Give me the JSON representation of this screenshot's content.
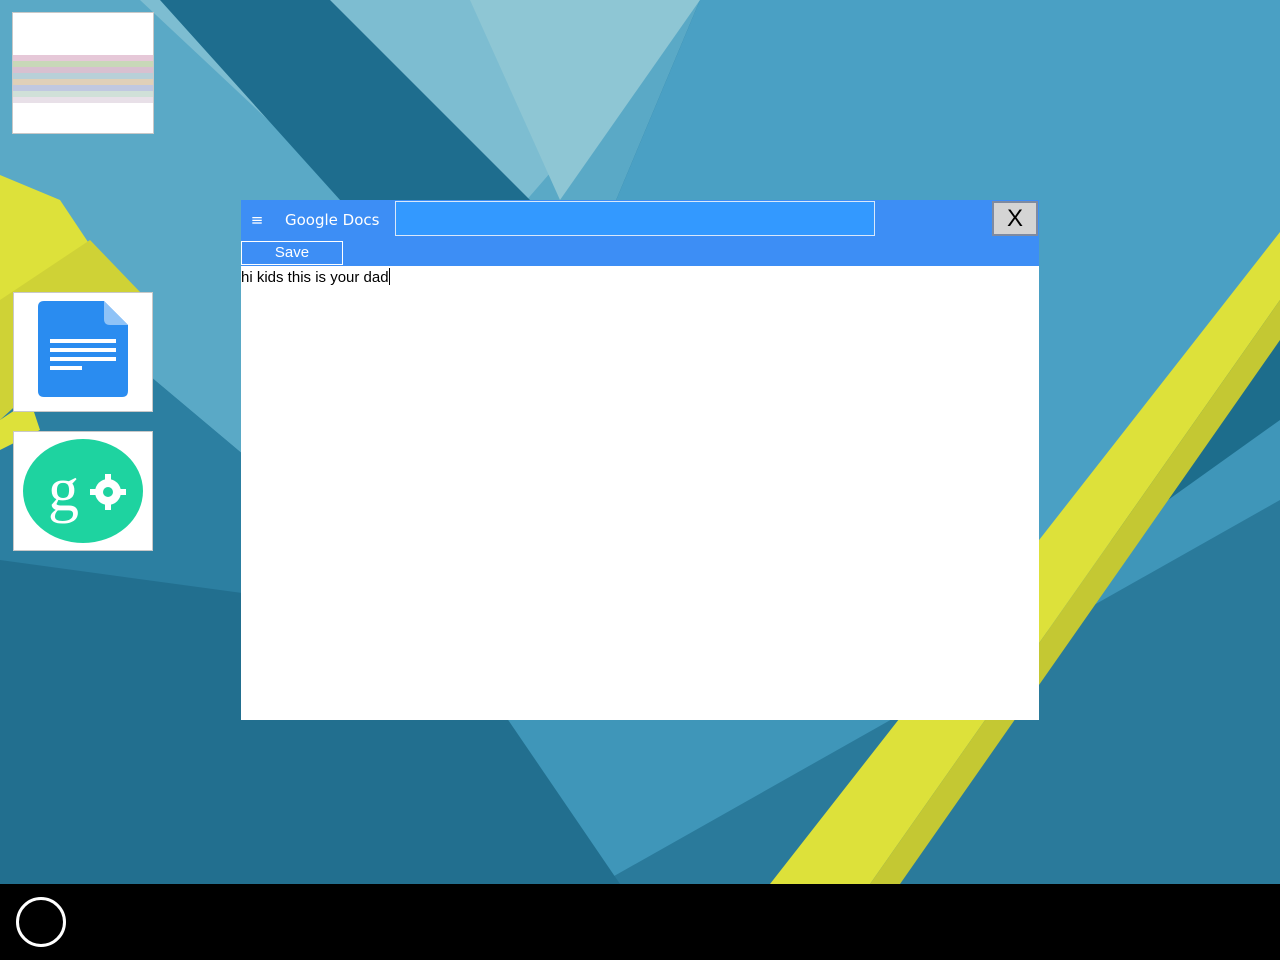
{
  "desktop": {
    "icons": [
      {
        "name": "thumbnail",
        "label": ""
      },
      {
        "name": "google-docs",
        "label": ""
      },
      {
        "name": "google-settings",
        "label": ""
      }
    ]
  },
  "window": {
    "menu_icon": "≡",
    "title": "Google Docs",
    "title_input_value": "",
    "close_label": "X",
    "save_label": "Save",
    "document_text": "hi kids this is your dad"
  },
  "colors": {
    "window_accent": "#3d8ef5",
    "title_input_bg": "#3399ff",
    "docs_icon_blue": "#2a8cf0",
    "gsettings_green": "#1ed3a0",
    "wallpaper_yellow": "#dde13a"
  }
}
